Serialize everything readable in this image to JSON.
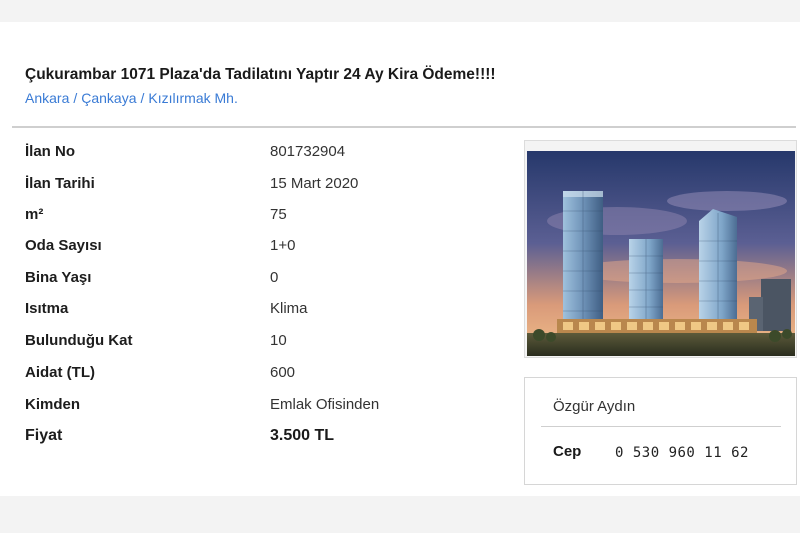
{
  "listing": {
    "title": "Çukurambar 1071 Plaza'da Tadilatını Yaptır 24 Ay Kira Ödeme!!!!",
    "breadcrumb": [
      "Ankara",
      "Çankaya",
      "Kızılırmak Mh."
    ],
    "details": [
      {
        "label": "İlan No",
        "value": "801732904"
      },
      {
        "label": "İlan Tarihi",
        "value": "15 Mart 2020"
      },
      {
        "label": "m²",
        "value": "75"
      },
      {
        "label": "Oda Sayısı",
        "value": "1+0"
      },
      {
        "label": "Bina Yaşı",
        "value": "0"
      },
      {
        "label": "Isıtma",
        "value": "Klima"
      },
      {
        "label": "Bulunduğu Kat",
        "value": "10"
      },
      {
        "label": "Aidat (TL)",
        "value": "600"
      },
      {
        "label": "Kimden",
        "value": "Emlak Ofisinden"
      }
    ],
    "price": {
      "label": "Fiyat",
      "value": "3.500 TL"
    }
  },
  "contact": {
    "name": "Özgür Aydın",
    "phone_label": "Cep",
    "phone_number": "0 530 960 11 62"
  },
  "colors": {
    "link": "#3a7bd5",
    "sky_top": "#2b3f73",
    "sky_horizon": "#f2b27a",
    "tower_glass": "#7fa6c9"
  }
}
